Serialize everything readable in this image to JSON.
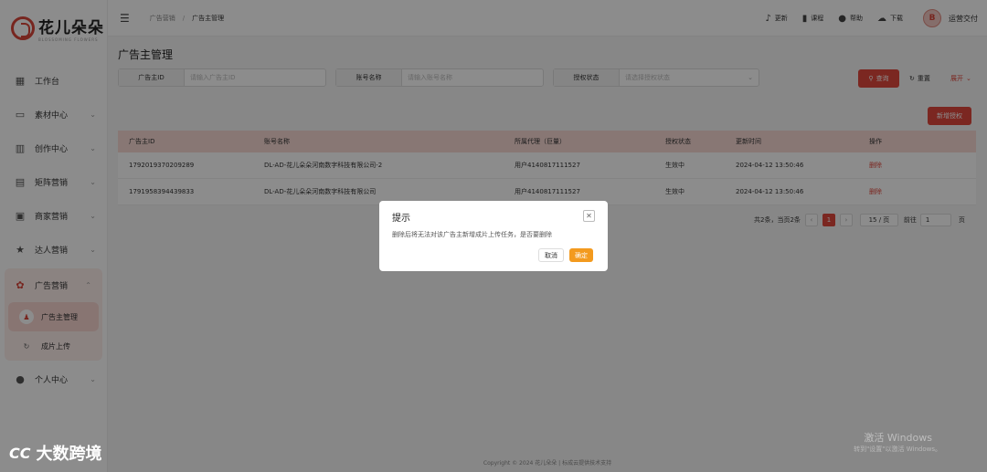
{
  "brand": {
    "name": "花儿朵朵",
    "sub": "BLOSSOMING FLOWERS"
  },
  "sidebar": {
    "items": [
      {
        "label": "工作台",
        "icon": "grid-icon"
      },
      {
        "label": "素材中心",
        "icon": "folder-icon"
      },
      {
        "label": "创作中心",
        "icon": "chart-icon"
      },
      {
        "label": "矩阵营销",
        "icon": "matrix-icon"
      },
      {
        "label": "商家营销",
        "icon": "store-icon"
      },
      {
        "label": "达人营销",
        "icon": "star-icon"
      },
      {
        "label": "广告营销",
        "icon": "ad-icon"
      },
      {
        "label": "个人中心",
        "icon": "user-icon"
      }
    ],
    "sub_items": [
      {
        "label": "广告主管理",
        "icon": "advertiser-icon"
      },
      {
        "label": "成片上传",
        "icon": "upload-icon"
      }
    ]
  },
  "topbar": {
    "breadcrumb": [
      "广告营销",
      "广告主管理"
    ],
    "actions": [
      "更新",
      "课程",
      "帮助",
      "下载"
    ],
    "username": "运营交付"
  },
  "page": {
    "title": "广告主管理"
  },
  "filters": [
    {
      "label": "广告主ID",
      "placeholder": "请输入广告主ID"
    },
    {
      "label": "账号名称",
      "placeholder": "请输入账号名称"
    },
    {
      "label": "授权状态",
      "placeholder": "请选择授权状态"
    }
  ],
  "buttons": {
    "search": "查询",
    "reset": "重置",
    "expand": "展开",
    "add": "新增授权"
  },
  "table": {
    "headers": [
      "广告主ID",
      "账号名称",
      "所属代理（巨量）",
      "授权状态",
      "更新时间",
      "操作"
    ],
    "rows": [
      {
        "id": "1792019370209289",
        "name": "DL-AD-花儿朵朵河南数字科技有限公司-2",
        "agent": "用户4140817111527",
        "status": "生效中",
        "time": "2024-04-12 13:50:46",
        "op": "删除"
      },
      {
        "id": "1791958394439833",
        "name": "DL-AD-花儿朵朵河南数字科技有限公司",
        "agent": "用户4140817111527",
        "status": "生效中",
        "time": "2024-04-12 13:50:46",
        "op": "删除"
      }
    ]
  },
  "pagination": {
    "summary": "共2条，当页2条",
    "current": "1",
    "page_size": "15 / 页",
    "jump_prefix": "前往",
    "jump_value": "1",
    "jump_suffix": "页"
  },
  "footer": "Copyright © 2024 花儿朵朵 | 标成云提供技术支持",
  "modal": {
    "title": "提示",
    "message": "删除后将无法对该广告主新增成片上传任务，是否要删除",
    "cancel": "取消",
    "confirm": "确定"
  },
  "watermark": {
    "text": "大数跨境",
    "mark": "CC"
  },
  "windows_activation": {
    "title": "激活 Windows",
    "sub": "转到\"设置\"以激活 Windows。"
  },
  "colors": {
    "accent": "#e0473c",
    "confirm": "#f39a1e"
  }
}
